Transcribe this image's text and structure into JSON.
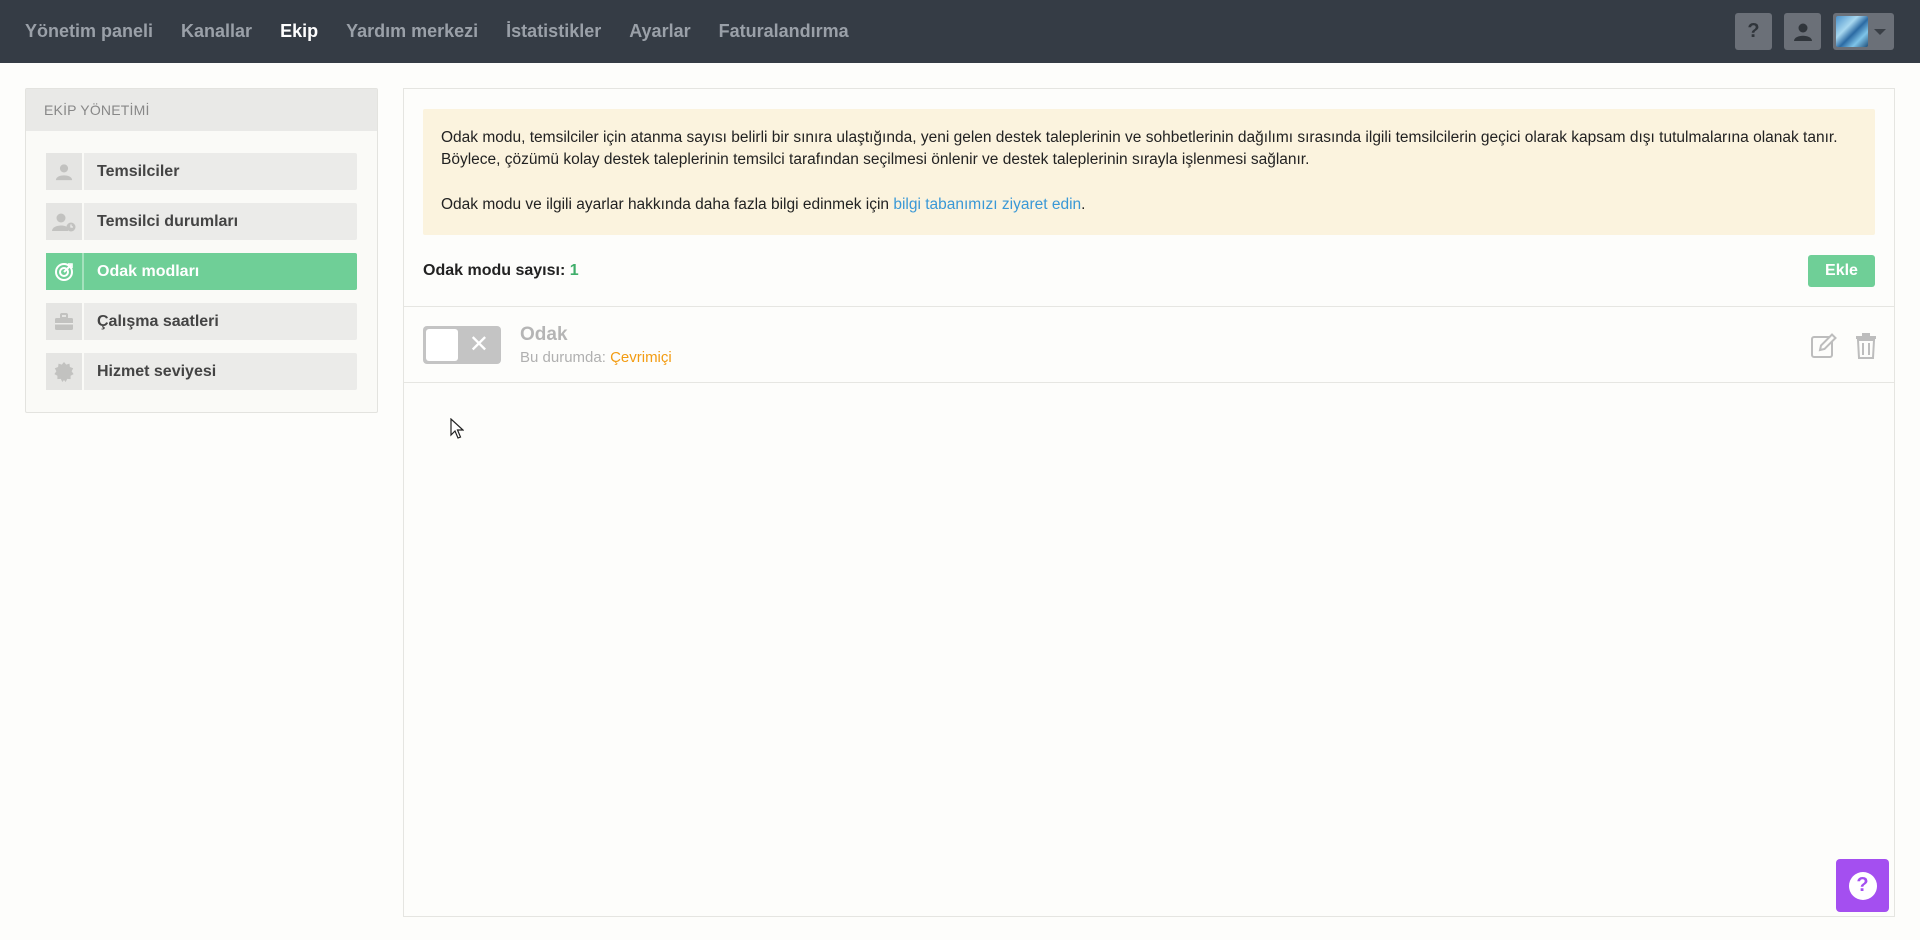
{
  "nav": {
    "items": [
      {
        "label": "Yönetim paneli"
      },
      {
        "label": "Kanallar"
      },
      {
        "label": "Ekip",
        "active": true
      },
      {
        "label": "Yardım merkezi"
      },
      {
        "label": "İstatistikler"
      },
      {
        "label": "Ayarlar"
      },
      {
        "label": "Faturalandırma"
      }
    ],
    "help_glyph": "?"
  },
  "sidebar": {
    "header": "EKİP YÖNETİMİ",
    "items": [
      {
        "label": "Temsilciler",
        "icon": "user-icon"
      },
      {
        "label": "Temsilci durumları",
        "icon": "user-status-icon"
      },
      {
        "label": "Odak modları",
        "icon": "target-icon",
        "active": true
      },
      {
        "label": "Çalışma saatleri",
        "icon": "briefcase-icon"
      },
      {
        "label": "Hizmet seviyesi",
        "icon": "badge-icon"
      }
    ]
  },
  "notice": {
    "paragraph1": "Odak modu, temsilciler için atanma sayısı belirli bir sınıra ulaştığında, yeni gelen destek taleplerinin ve sohbetlerinin dağılımı sırasında ilgili temsilcilerin geçici olarak kapsam dışı tutulmalarına olanak tanır. Böylece, çözümü kolay destek taleplerinin temsilci tarafından seçilmesi önlenir ve destek taleplerinin sırayla işlenmesi sağlanır.",
    "paragraph2_prefix": "Odak modu ve ilgili ayarlar hakkında daha fazla bilgi edinmek için ",
    "link_text": "bilgi tabanımızı ziyaret edin",
    "paragraph2_suffix": "."
  },
  "count": {
    "label": "Odak modu sayısı:",
    "value": "1"
  },
  "add_button": "Ekle",
  "focus_modes": [
    {
      "title": "Odak",
      "status_prefix": "Bu durumda:",
      "status_value": "Çevrimiçi",
      "enabled": false
    }
  ],
  "toggle_off_glyph": "✕",
  "colors": {
    "topbar": "#353c45",
    "accent_green": "#6fcf97",
    "notice_bg": "#fbf3de",
    "link_blue": "#3a98d6",
    "status_orange": "#f39c12",
    "help_purple": "#a44ff0"
  }
}
